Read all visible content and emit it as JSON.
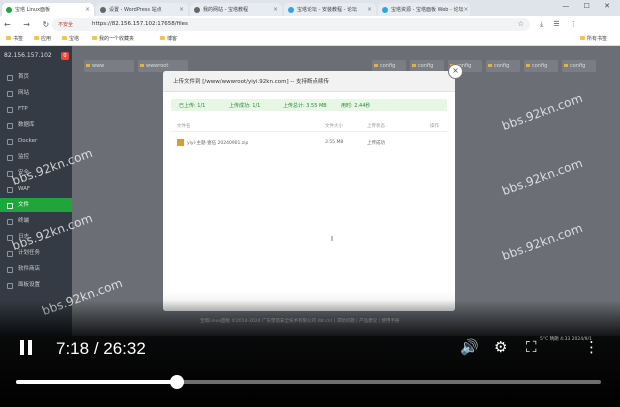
{
  "browser": {
    "tabs": [
      {
        "label": "宝塔 Linux面板",
        "active": true
      },
      {
        "label": "设置 - WordPress 站点",
        "active": false
      },
      {
        "label": "我的网站 - 宝塔教程",
        "active": false
      },
      {
        "label": "宝塔论坛 - 安装教程 - 论坛",
        "active": false
      },
      {
        "label": "宝塔资源 - 宝塔面板 Web - 论坛",
        "active": false
      }
    ],
    "win_controls": "— ☐ ✕",
    "nav_icons": "← → ↻",
    "secure_label": "不安全",
    "url": "https://82.156.157.102:17658/files",
    "toolbar_icons": "⤓ ☰ ⋮",
    "bookmarks": [
      "书签",
      "应用",
      "宝塔",
      "我的一个收藏夹",
      "博客"
    ],
    "bookmarks_right": "所有书签"
  },
  "sidebar": {
    "ip": "82.156.157.102",
    "badge": "0",
    "items": [
      {
        "label": "首页",
        "active": false
      },
      {
        "label": "网站",
        "active": false
      },
      {
        "label": "FTP",
        "active": false
      },
      {
        "label": "数据库",
        "active": false
      },
      {
        "label": "Docker",
        "active": false
      },
      {
        "label": "监控",
        "active": false
      },
      {
        "label": "安全",
        "active": false
      },
      {
        "label": "WAF",
        "active": false
      },
      {
        "label": "文件",
        "active": true
      },
      {
        "label": "终端",
        "active": false
      },
      {
        "label": "日志",
        "active": false
      },
      {
        "label": "计划任务",
        "active": false
      },
      {
        "label": "软件商店",
        "active": false
      },
      {
        "label": "面板设置",
        "active": false
      }
    ]
  },
  "main": {
    "folders": [
      "www",
      "wwwroot",
      "config",
      "config",
      "config",
      "config",
      "config",
      "config",
      "config",
      "config"
    ],
    "footer": "宝塔Linux面板 ©2014-2024 广东堡塔安全技术有限公司 (bt.cn) | 求助问题 | 产品建议 | 使用手册",
    "watermark": "bbs.92kn.com"
  },
  "modal": {
    "title": "上传文件到 [/www/wwwroot/yiyi.92kn.com] -- 支持断点续传",
    "status": {
      "uploaded": "已上传: 1/1",
      "success": "上传成功: 1/1",
      "total_size": "上传总计: 3.55 MB",
      "time": "用时: 2.44秒"
    },
    "columns": [
      "文件名",
      "文件大小",
      "上传状态",
      "操作"
    ],
    "file": {
      "name": "yiyi-主题-壹伍 20240901.zip",
      "size": "3.55 MB",
      "status": "上传成功"
    }
  },
  "player": {
    "current": "7:18",
    "duration": "26:32",
    "progress": 0.275,
    "icons": [
      "volume-icon",
      "settings-icon",
      "fullscreen-icon",
      "more-icon"
    ],
    "taskbar": "5°C 晴朗  4:33  2024/9/1"
  }
}
